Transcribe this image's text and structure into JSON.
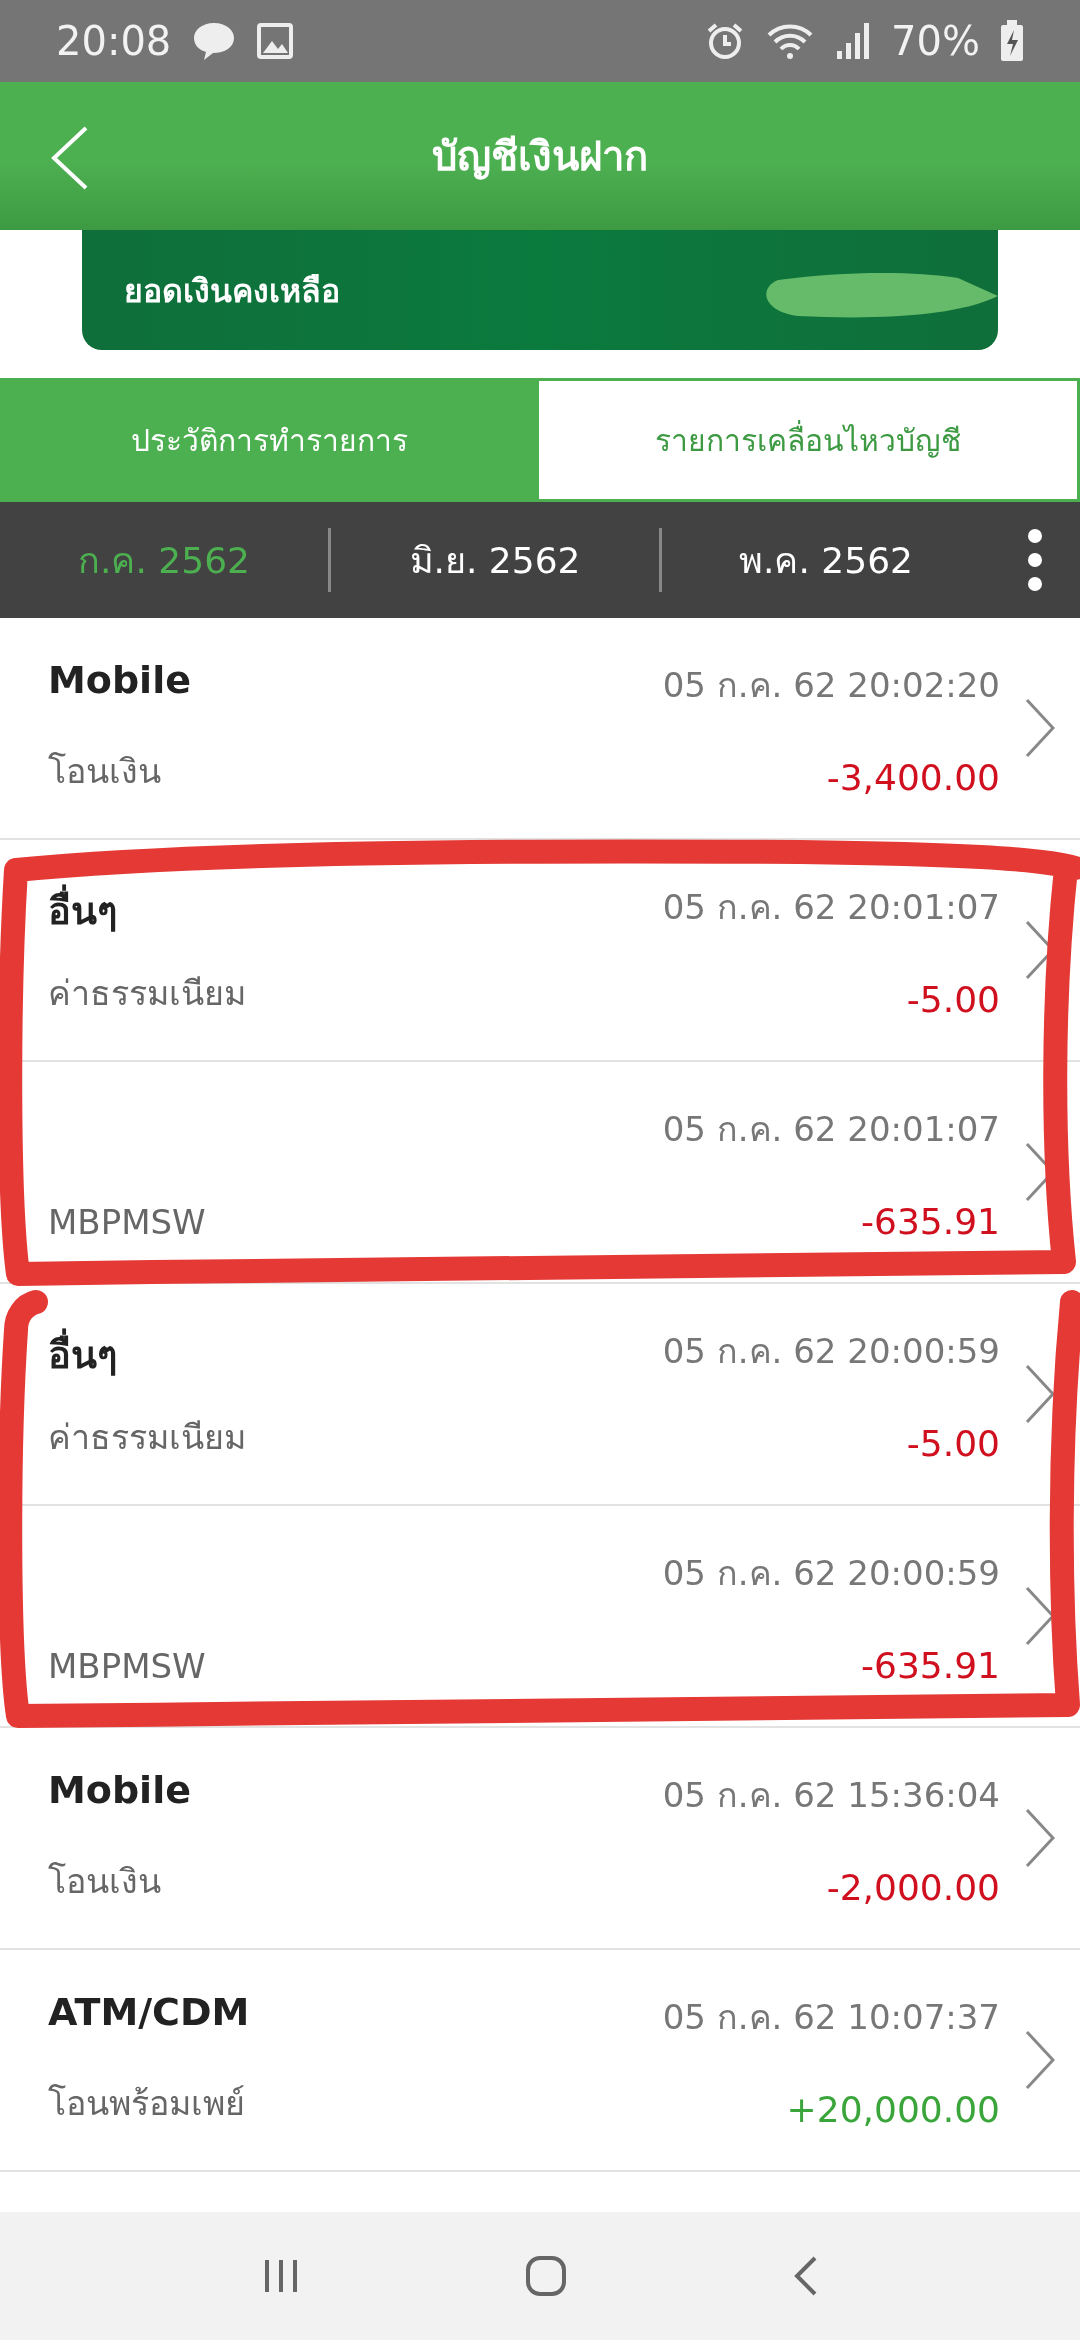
{
  "status_bar": {
    "time": "20:08",
    "battery": "70%"
  },
  "header": {
    "title": "บัญชีเงินฝาก"
  },
  "balance_card": {
    "label": "ยอดเงินคงเหลือ",
    "masked": true
  },
  "tabs": [
    {
      "label": "ประวัติการทำรายการ",
      "selected": false
    },
    {
      "label": "รายการเคลื่อนไหวบัญชี",
      "selected": true
    }
  ],
  "months": [
    {
      "label": "ก.ค. 2562",
      "selected": true
    },
    {
      "label": "มิ.ย. 2562",
      "selected": false
    },
    {
      "label": "พ.ค. 2562",
      "selected": false
    }
  ],
  "transactions": [
    {
      "title": "Mobile",
      "description": "โอนเงิน",
      "datetime": "05 ก.ค. 62 20:02:20",
      "amount": "-3,400.00",
      "kind": "debit"
    },
    {
      "title": "อื่นๆ",
      "description": "ค่าธรรมเนียม",
      "datetime": "05 ก.ค. 62 20:01:07",
      "amount": "-5.00",
      "kind": "debit"
    },
    {
      "description": "MBPMSW",
      "datetime": "05 ก.ค. 62 20:01:07",
      "amount": "-635.91",
      "kind": "debit"
    },
    {
      "title": "อื่นๆ",
      "description": "ค่าธรรมเนียม",
      "datetime": "05 ก.ค. 62 20:00:59",
      "amount": "-5.00",
      "kind": "debit"
    },
    {
      "description": "MBPMSW",
      "datetime": "05 ก.ค. 62 20:00:59",
      "amount": "-635.91",
      "kind": "debit"
    },
    {
      "title": "Mobile",
      "description": "โอนเงิน",
      "datetime": "05 ก.ค. 62 15:36:04",
      "amount": "-2,000.00",
      "kind": "debit"
    },
    {
      "title": "ATM/CDM",
      "description": "โอนพร้อมเพย์",
      "datetime": "05 ก.ค. 62 10:07:37",
      "amount": "+20,000.00",
      "kind": "credit"
    }
  ],
  "annotations": [
    {
      "kind": "loop"
    },
    {
      "kind": "loop"
    }
  ]
}
